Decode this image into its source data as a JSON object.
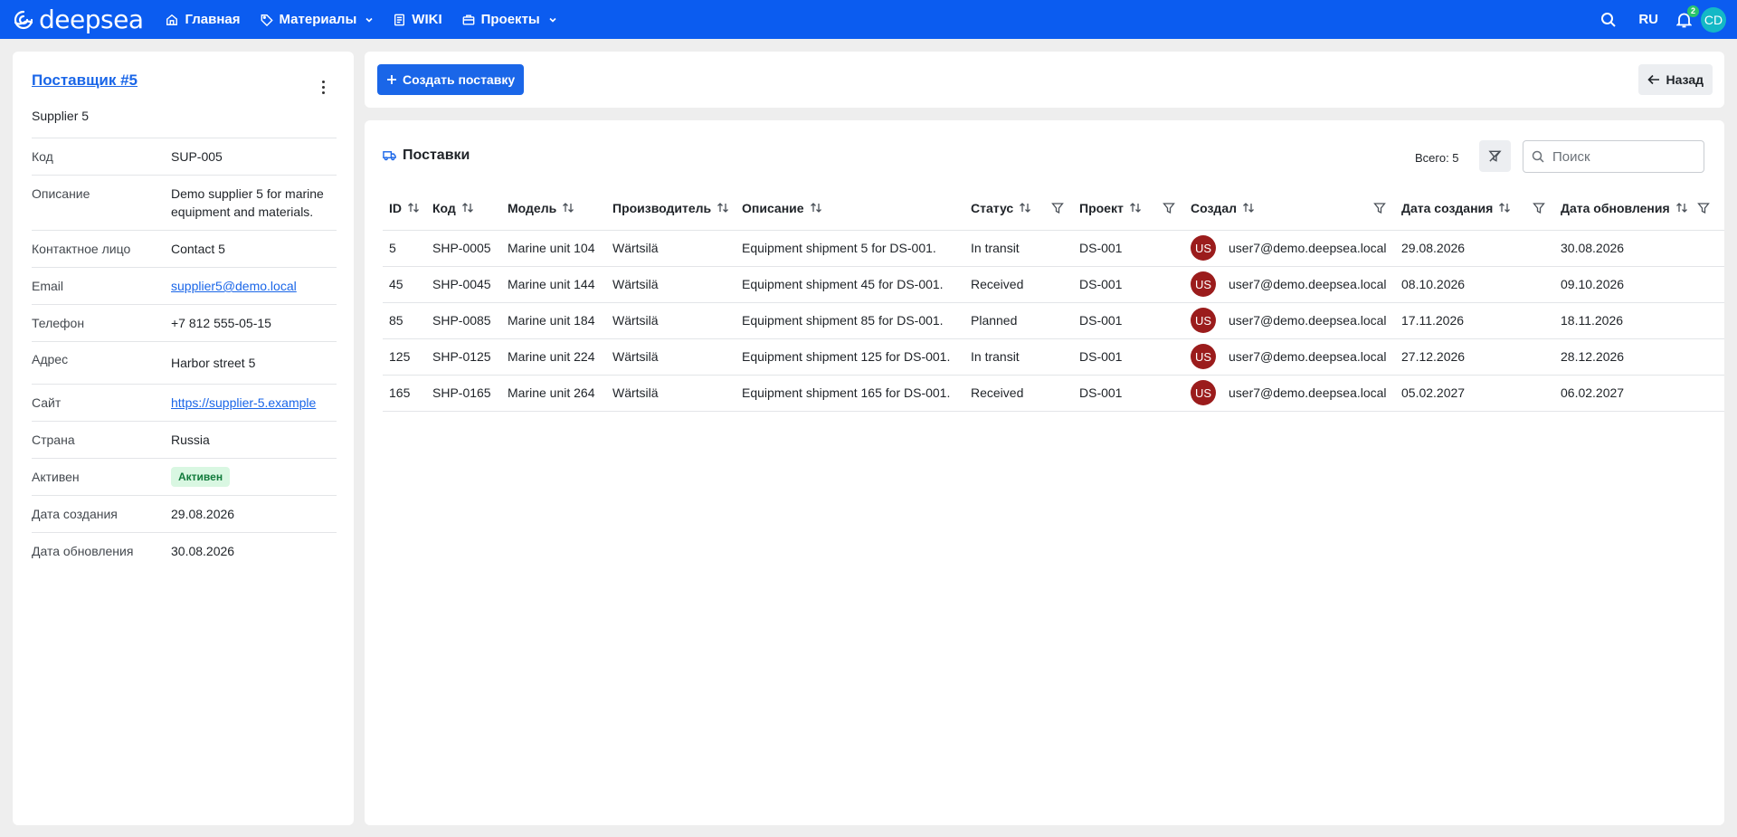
{
  "topbar": {
    "logo_text": "deepsea",
    "nav": [
      {
        "label": "Главная",
        "icon": "home-icon",
        "has_dropdown": false
      },
      {
        "label": "Материалы",
        "icon": "tag-icon",
        "has_dropdown": true
      },
      {
        "label": "WIKI",
        "icon": "book-icon",
        "has_dropdown": false
      },
      {
        "label": "Проекты",
        "icon": "briefcase-icon",
        "has_dropdown": true
      }
    ],
    "lang": "RU",
    "notifications_count": "2",
    "user_initials": "CD"
  },
  "supplier": {
    "title": "Поставщик #5",
    "subtitle": "Supplier 5",
    "fields": {
      "code": {
        "label": "Код",
        "value": "SUP-005"
      },
      "description": {
        "label": "Описание",
        "value": "Demo supplier 5 for marine equipment and materials."
      },
      "contact": {
        "label": "Контактное лицо",
        "value": "Contact 5"
      },
      "email": {
        "label": "Email",
        "value": "supplier5@demo.local"
      },
      "phone": {
        "label": "Телефон",
        "value": "+7 812 555-05-15"
      },
      "address": {
        "label": "Адрес",
        "value": "Harbor street 5"
      },
      "site": {
        "label": "Сайт",
        "value": "https://supplier-5.example"
      },
      "country": {
        "label": "Страна",
        "value": "Russia"
      },
      "active": {
        "label": "Активен",
        "value": "Активен"
      },
      "created": {
        "label": "Дата создания",
        "value": "29.08.2026"
      },
      "updated": {
        "label": "Дата обновления",
        "value": "30.08.2026"
      }
    }
  },
  "actions": {
    "create_label": "Создать поставку",
    "back_label": "Назад"
  },
  "shipments": {
    "title": "Поставки",
    "total_label": "Всего: 5",
    "search_placeholder": "Поиск",
    "columns": {
      "id": "ID",
      "code": "Код",
      "model": "Модель",
      "manufacturer": "Производитель",
      "description": "Описание",
      "status": "Статус",
      "project": "Проект",
      "created_by": "Создал",
      "created_at": "Дата создания",
      "updated_at": "Дата обновления"
    },
    "rows": [
      {
        "id": "5",
        "code": "SHP-0005",
        "model": "Marine unit 104",
        "manufacturer": "Wärtsilä",
        "description": "Equipment shipment 5 for DS-001.",
        "status": "In transit",
        "project": "DS-001",
        "avatar": "US",
        "user": "user7@demo.deepsea.local",
        "created_at": "29.08.2026",
        "updated_at": "30.08.2026"
      },
      {
        "id": "45",
        "code": "SHP-0045",
        "model": "Marine unit 144",
        "manufacturer": "Wärtsilä",
        "description": "Equipment shipment 45 for DS-001.",
        "status": "Received",
        "project": "DS-001",
        "avatar": "US",
        "user": "user7@demo.deepsea.local",
        "created_at": "08.10.2026",
        "updated_at": "09.10.2026"
      },
      {
        "id": "85",
        "code": "SHP-0085",
        "model": "Marine unit 184",
        "manufacturer": "Wärtsilä",
        "description": "Equipment shipment 85 for DS-001.",
        "status": "Planned",
        "project": "DS-001",
        "avatar": "US",
        "user": "user7@demo.deepsea.local",
        "created_at": "17.11.2026",
        "updated_at": "18.11.2026"
      },
      {
        "id": "125",
        "code": "SHP-0125",
        "model": "Marine unit 224",
        "manufacturer": "Wärtsilä",
        "description": "Equipment shipment 125 for DS-001.",
        "status": "In transit",
        "project": "DS-001",
        "avatar": "US",
        "user": "user7@demo.deepsea.local",
        "created_at": "27.12.2026",
        "updated_at": "28.12.2026"
      },
      {
        "id": "165",
        "code": "SHP-0165",
        "model": "Marine unit 264",
        "manufacturer": "Wärtsilä",
        "description": "Equipment shipment 165 for DS-001.",
        "status": "Received",
        "project": "DS-001",
        "avatar": "US",
        "user": "user7@demo.deepsea.local",
        "created_at": "05.02.2027",
        "updated_at": "06.02.2027"
      }
    ]
  },
  "colors": {
    "topbar": "#0b5cf0",
    "primary": "#1a66e8",
    "avatar_user": "#9b1c1c",
    "avatar_top": "#14b8c6",
    "badge_active_bg": "#d9f7e2",
    "badge_active_text": "#117a3b"
  }
}
